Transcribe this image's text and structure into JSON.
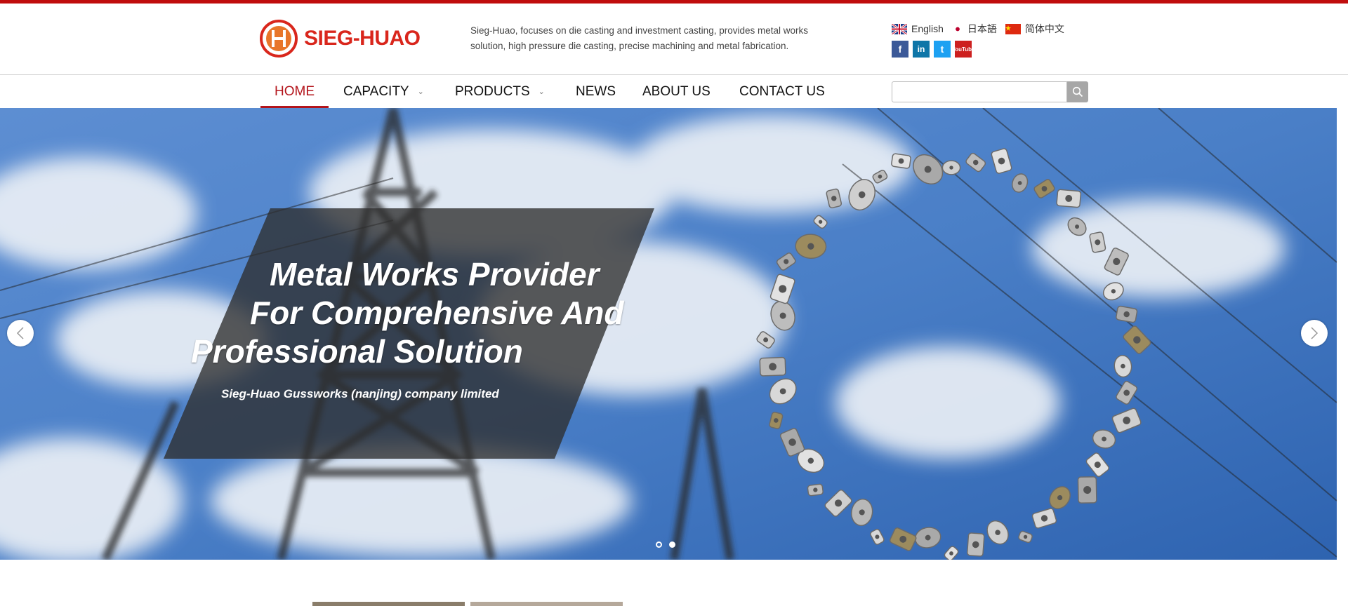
{
  "brand": {
    "name": "SIEG-HUAO",
    "tagline": "Sieg-Huao, focuses on die casting and investment casting, provides metal works solution, high pressure die casting, precise machining and metal fabrication.",
    "accent_color": "#c00d0d",
    "logo_color": "#d9261c"
  },
  "languages": [
    {
      "label": "English",
      "icon": "uk-flag-icon"
    },
    {
      "label": "日本語",
      "icon": "japan-flag-icon"
    },
    {
      "label": "简体中文",
      "icon": "china-flag-icon"
    }
  ],
  "social": [
    {
      "label": "f",
      "icon": "facebook-icon"
    },
    {
      "label": "in",
      "icon": "linkedin-icon"
    },
    {
      "label": "t",
      "icon": "twitter-icon"
    },
    {
      "label": "YouTube",
      "icon": "youtube-icon"
    }
  ],
  "nav": {
    "items": [
      {
        "label": "HOME",
        "active": true
      },
      {
        "label": "CAPACITY",
        "has_dropdown": true
      },
      {
        "label": "PRODUCTS",
        "has_dropdown": true
      },
      {
        "label": "NEWS"
      },
      {
        "label": "ABOUT US"
      },
      {
        "label": "CONTACT US"
      }
    ],
    "active_color": "#b3141b"
  },
  "search": {
    "value": "",
    "placeholder": "",
    "icon": "search-icon"
  },
  "hero": {
    "headline_lines": [
      "Metal Works Provider",
      "For Comprehensive And",
      "Professional Solution"
    ],
    "subline": "Sieg-Huao Gussworks (nanjing) company limited",
    "slide_count": 2,
    "active_slide": 2,
    "prev_icon": "chevron-left-icon",
    "next_icon": "chevron-right-icon"
  }
}
